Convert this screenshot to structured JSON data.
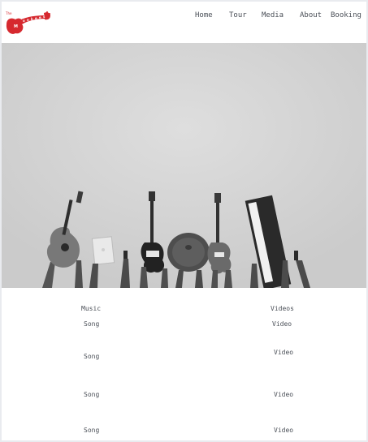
{
  "brand": {
    "small_text": "The",
    "name": "Monkees",
    "color": "#d6292f"
  },
  "nav": {
    "items": [
      "Home",
      "Tour",
      "Media",
      "About",
      "Booking"
    ]
  },
  "hero": {
    "description_icon": "instruments-raised-photo"
  },
  "media": {
    "music_header": "Music",
    "videos_header": "Videos",
    "songs": [
      "Song",
      "Song",
      "Song",
      "Song"
    ],
    "videos": [
      "Video",
      "Video",
      "Video",
      "Video"
    ]
  }
}
